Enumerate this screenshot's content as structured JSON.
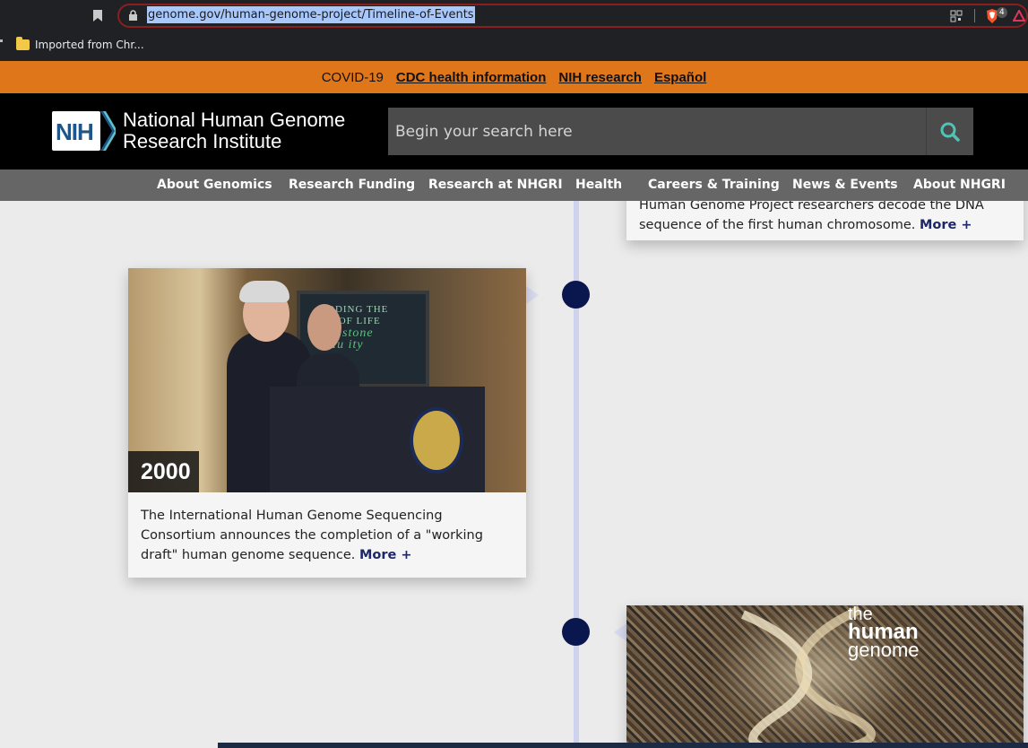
{
  "browser": {
    "url": "genome.gov/human-genome-project/Timeline-of-Events",
    "bookmark_folder": "Imported from Chr...",
    "extension_badge": "4"
  },
  "alert_bar": {
    "prefix": "COVID-19",
    "links": [
      "CDC health information",
      "NIH research",
      "Español"
    ]
  },
  "header": {
    "logo_text": "NIH",
    "institute_line1": "National Human Genome",
    "institute_line2": "Research Institute",
    "search_placeholder": "Begin your search here"
  },
  "nav": {
    "items": [
      "About Genomics",
      "Research Funding",
      "Research at NHGRI",
      "Health",
      "Careers & Training",
      "News & Events",
      "About NHGRI"
    ]
  },
  "timeline": {
    "top_card": {
      "text": "Human Genome Project researchers decode the DNA sequence of the first human chromosome.",
      "more": "More +"
    },
    "card_2000": {
      "year": "2000",
      "text": "The International Human Genome Sequencing Consortium announces the completion of a \"working draft\" human genome sequence.",
      "more": "More +",
      "photo_overlay_text": [
        "ODING THE",
        "K OF LIFE",
        "ilestone",
        "Hu  ity"
      ]
    },
    "bottom_card": {
      "overlay_line1": "the",
      "overlay_line2": "human",
      "overlay_line3": "genome"
    }
  },
  "colors": {
    "alert": "#e0761a",
    "header": "#000000",
    "nav": "#666666",
    "timeline_dot": "#0a164e",
    "timeline_line": "#cfd2ee",
    "search_icon": "#4fc3b5"
  }
}
